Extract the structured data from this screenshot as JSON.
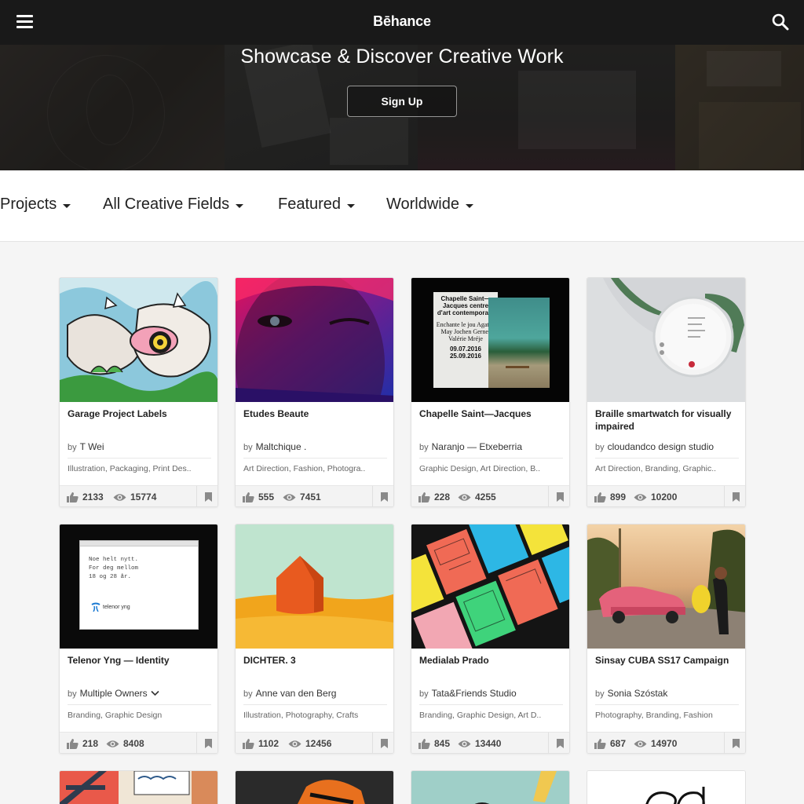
{
  "header": {
    "logo": "Bēhance",
    "hero_title": "Showcase & Discover Creative Work",
    "signup_label": "Sign Up"
  },
  "filters": [
    {
      "label": "Projects"
    },
    {
      "label": "All Creative Fields"
    },
    {
      "label": "Featured"
    },
    {
      "label": "Worldwide"
    }
  ],
  "projects": [
    {
      "title": "Garage Project Labels",
      "by": "by",
      "owner": "T Wei",
      "tags": "Illustration, Packaging, Print Des..",
      "likes": "2133",
      "views": "15774"
    },
    {
      "title": "Etudes Beaute",
      "by": "by",
      "owner": "Maltchique .",
      "tags": "Art Direction, Fashion, Photogra..",
      "likes": "555",
      "views": "7451"
    },
    {
      "title": "Chapelle Saint—Jacques",
      "by": "by",
      "owner": "Naranjo — Etxeberria",
      "tags": "Graphic Design, Art Direction, B..",
      "likes": "228",
      "views": "4255"
    },
    {
      "title": "Braille smartwatch for visually impaired",
      "by": "by",
      "owner": "cloudandco design studio",
      "tags": "Art Direction, Branding, Graphic..",
      "likes": "899",
      "views": "10200"
    },
    {
      "title": "Telenor Yng — Identity",
      "by": "by",
      "owner": "Multiple Owners",
      "tags": "Branding, Graphic Design",
      "likes": "218",
      "views": "8408"
    },
    {
      "title": "DICHTER. 3",
      "by": "by",
      "owner": "Anne van den Berg",
      "tags": "Illustration, Photography, Crafts",
      "likes": "1102",
      "views": "12456"
    },
    {
      "title": "Medialab Prado",
      "by": "by",
      "owner": "Tata&Friends Studio",
      "tags": "Branding, Graphic Design, Art D..",
      "likes": "845",
      "views": "13440"
    },
    {
      "title": "Sinsay CUBA SS17 Campaign",
      "by": "by",
      "owner": "Sonia Szóstak",
      "tags": "Photography, Branding, Fashion",
      "likes": "687",
      "views": "14970"
    }
  ],
  "thumb_text": {
    "chapelle_poster": "Chapelle Saint—Jacques centre d'art contemporain",
    "chapelle_names": "Enchante le jou Agathe May Jochen Gerner Valérie Mréje",
    "chapelle_dates": "09.07.2016 25.09.2016",
    "telenor_text_1": "Noe helt nytt.",
    "telenor_text_2": "For deg mellom",
    "telenor_text_3": "18 og 28 år.",
    "telenor_logo": "telenor yng"
  },
  "icons": {
    "menu": "hamburger-icon",
    "search": "search-icon",
    "like": "thumbs-up-icon",
    "view": "eye-icon",
    "save": "bookmark-icon",
    "dropdown": "caret-down-icon"
  }
}
